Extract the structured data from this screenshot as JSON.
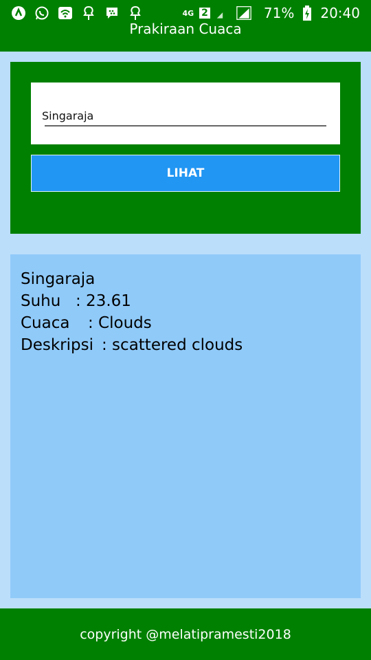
{
  "statusbar": {
    "network": "4G",
    "sim": "2",
    "battery": "71%",
    "time": "20:40"
  },
  "app": {
    "title": "Prakiraan Cuaca"
  },
  "search": {
    "value": "Singaraja",
    "button_label": "LIHAT"
  },
  "result": {
    "city": "Singaraja",
    "suhu_label": "Suhu",
    "suhu_value": ": 23.61",
    "cuaca_label": "Cuaca",
    "cuaca_value": ": Clouds",
    "deskripsi_label": "Deskripsi",
    "deskripsi_value": ": scattered clouds"
  },
  "footer": {
    "text": "copyright @melatipramesti2018"
  },
  "colors": {
    "primary_green": "#008000",
    "button_blue": "#2196f3",
    "background": "#bbdefb",
    "result_panel": "#90caf9"
  }
}
